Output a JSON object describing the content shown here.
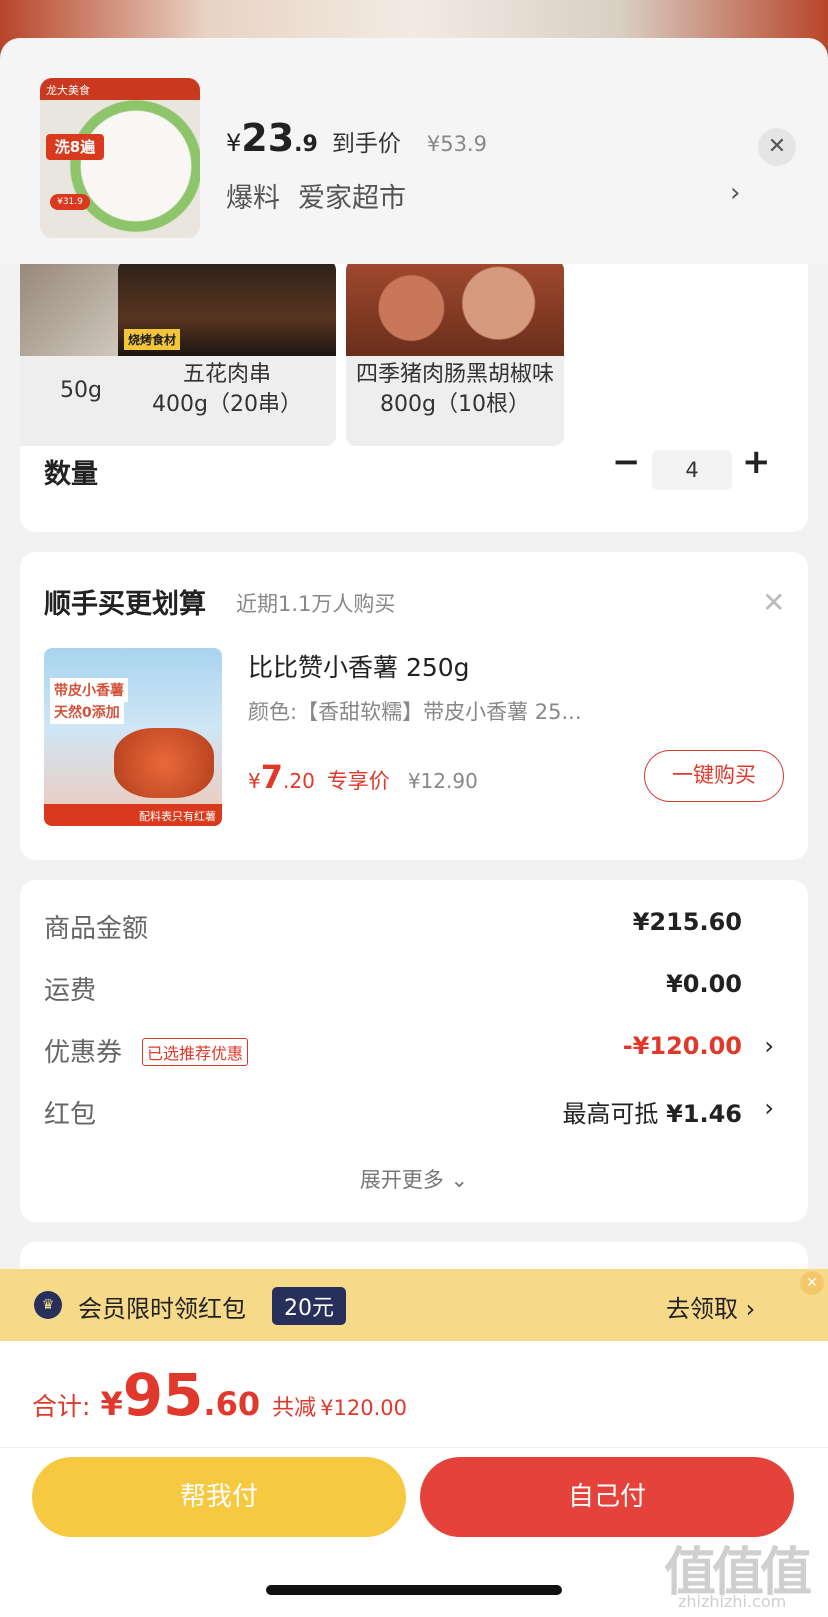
{
  "product": {
    "thumb_top": "龙大美食",
    "thumb_badge": "洗8遍",
    "thumb_price": "¥31.9",
    "price_symbol": "¥",
    "price_int": "23",
    "price_dec": ".9",
    "price_label": "到手价",
    "orig_price": "¥53.9",
    "shop_tag": "爆料",
    "shop_name": "爱家超市"
  },
  "variants": [
    {
      "name": "50g"
    },
    {
      "name": "五花肉串\n400g（20串）",
      "img_label": "烧烤食材"
    },
    {
      "name": "四季猪肉肠黑胡椒味800g（10根）"
    }
  ],
  "quantity": {
    "label": "数量",
    "value": "4"
  },
  "upsell": {
    "title": "顺手买更划算",
    "subtitle": "近期1.1万人购买",
    "img_t1": "带皮小香薯",
    "img_t2": "天然0添加",
    "img_bottom": "配料表只有红薯",
    "name": "比比赞小香薯 250g",
    "spec": "颜色:【香甜软糯】带皮小香薯 25...",
    "price_symbol": "¥",
    "price_int": "7",
    "price_dec": ".20",
    "price_label": "专享价",
    "orig_price": "¥12.90",
    "buy_label": "一键购买"
  },
  "summary": {
    "goods_label": "商品金额",
    "goods_value": "¥215.60",
    "ship_label": "运费",
    "ship_value": "¥0.00",
    "coupon_label": "优惠券",
    "coupon_tag": "已选推荐优惠",
    "coupon_value": "-¥120.00",
    "redpack_label": "红包",
    "redpack_prefix": "最高可抵",
    "redpack_value": "¥1.46",
    "expand_label": "展开更多"
  },
  "member": {
    "text": "会员限时领红包",
    "amount": "20元",
    "action": "去领取 ›"
  },
  "footer": {
    "total_label": "合计:",
    "total_symbol": "¥",
    "total_int": "95",
    "total_dec": ".60",
    "off_label": "共减",
    "off_value": "¥120.00",
    "help_pay": "帮我付",
    "self_pay": "自己付"
  },
  "watermark": {
    "main": "值值值",
    "sub": "zhizhizhi.com"
  },
  "colors": {
    "accent_red": "#e0392b",
    "pay_yellow": "#f7c940",
    "pay_red": "#e4423b",
    "member_bar": "#f7d98a"
  }
}
